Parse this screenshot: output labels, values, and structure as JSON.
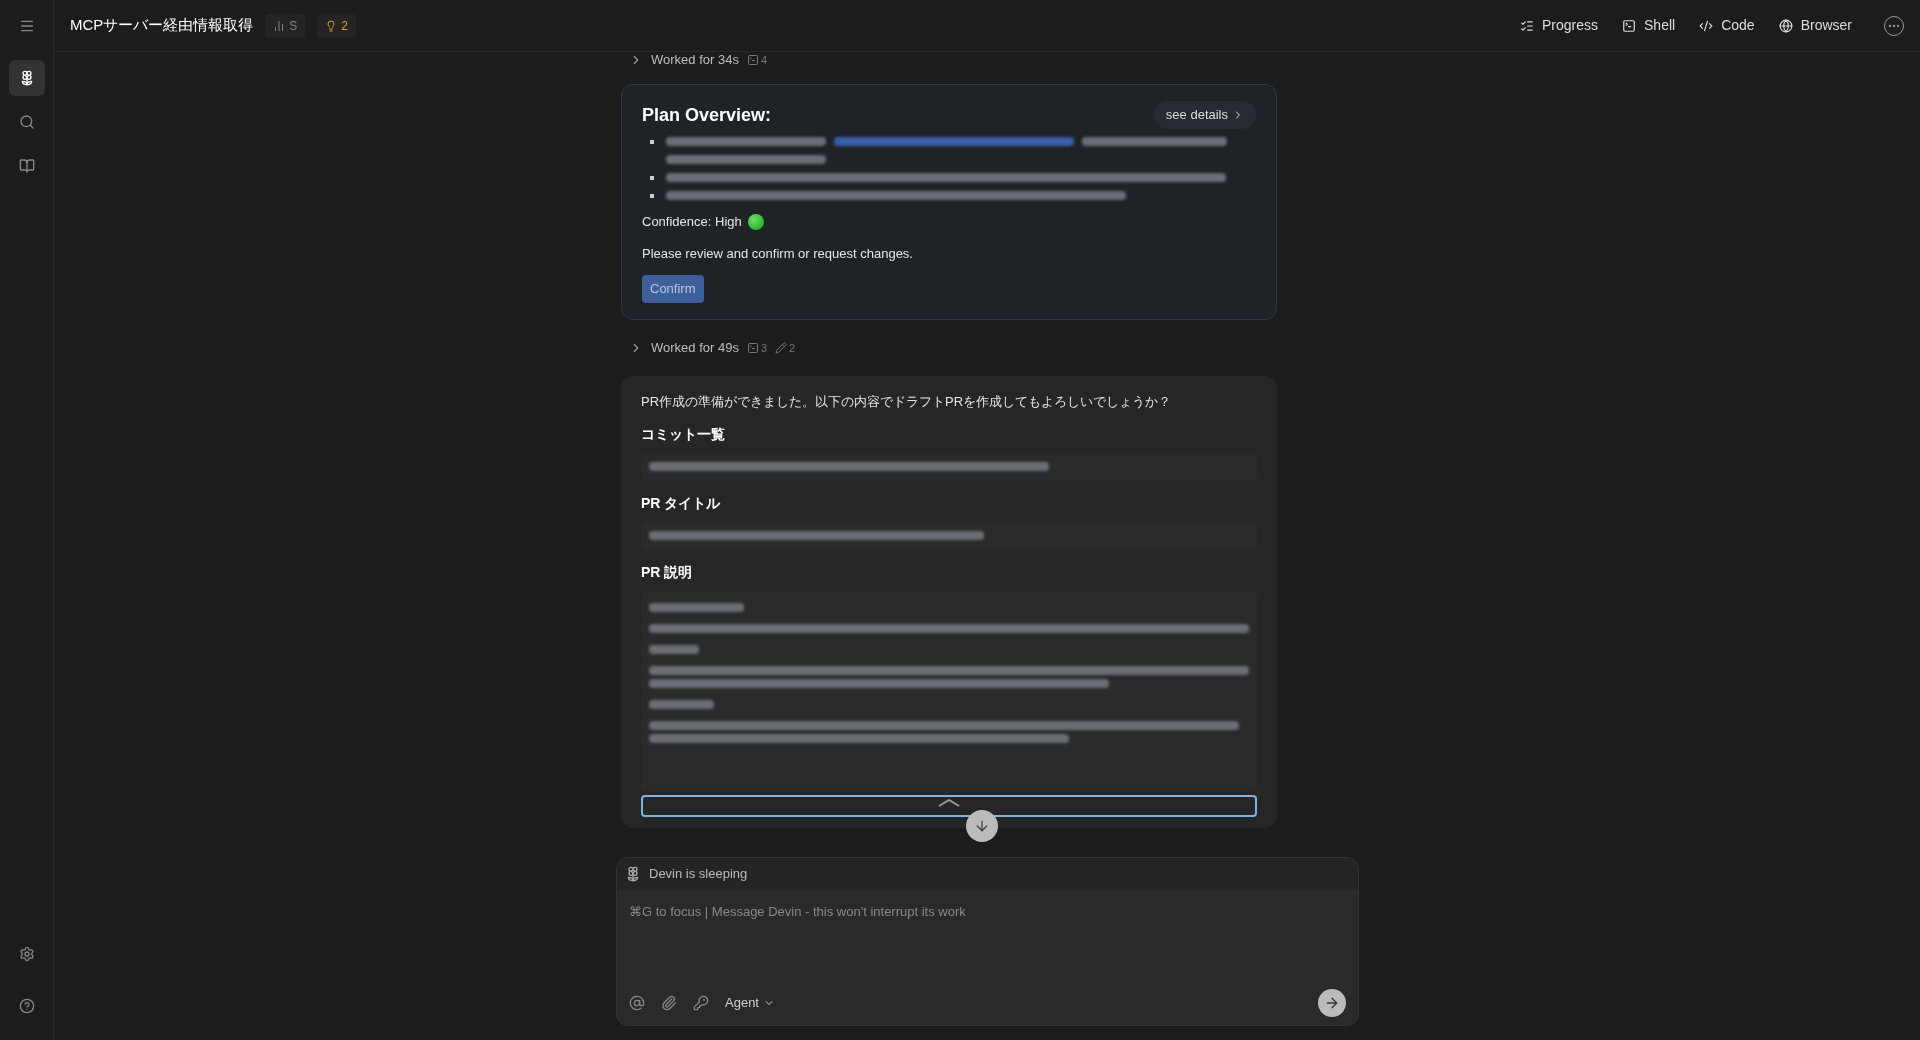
{
  "top_bar": {
    "title": "MCPサーバー経由情報取得",
    "badges": [
      {
        "kind": "stats",
        "text": "S"
      },
      {
        "kind": "alerts",
        "text": "2"
      }
    ],
    "tabs": [
      {
        "kind": "progress",
        "label": "Progress"
      },
      {
        "kind": "shell",
        "label": "Shell"
      },
      {
        "kind": "code",
        "label": "Code"
      },
      {
        "kind": "browser",
        "label": "Browser"
      }
    ]
  },
  "sidebar": {
    "items": [
      {
        "kind": "devin",
        "selected": true
      },
      {
        "kind": "search",
        "selected": false
      },
      {
        "kind": "docs",
        "selected": false
      }
    ],
    "bottom_items": [
      {
        "kind": "settings"
      },
      {
        "kind": "help"
      }
    ]
  },
  "work_log_1": {
    "label": "Worked for 34s",
    "counts": [
      {
        "kind": "terminal",
        "text": "4"
      }
    ]
  },
  "plan_card": {
    "title": "Plan Overview:",
    "details_button": "see details",
    "confidence": "Confidence: High",
    "note": "Please review and confirm or request changes.",
    "confirm_button": "Confirm"
  },
  "work_log_2": {
    "label": "Worked for 49s",
    "counts": [
      {
        "kind": "terminal",
        "text": "3"
      },
      {
        "kind": "edit",
        "text": "2"
      }
    ]
  },
  "pr_card": {
    "intro": "PR作成の準備ができました。以下の内容でドラフトPRを作成してもよろしいでしょうか？",
    "sections": [
      {
        "heading": "コミット一覧",
        "kind": "line"
      },
      {
        "heading": "PR タイトル",
        "kind": "line"
      },
      {
        "heading": "PR 説明",
        "kind": "block"
      }
    ]
  },
  "composer": {
    "status": "Devin is sleeping",
    "placeholder": "⌘G to focus | Message Devin - this won't interrupt its work",
    "mode": "Agent"
  }
}
